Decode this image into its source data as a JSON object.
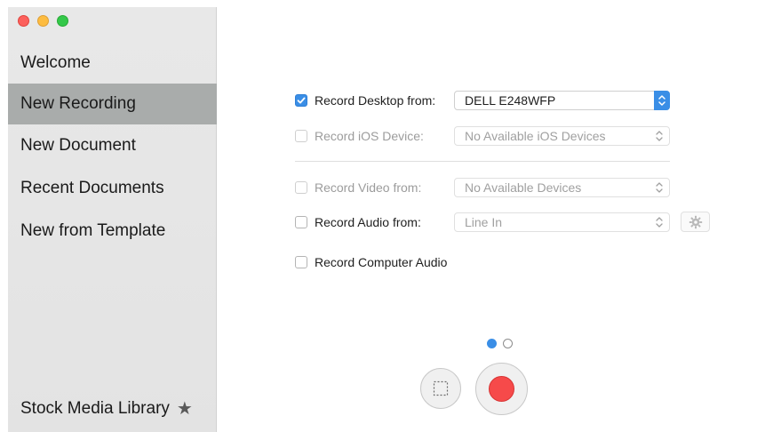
{
  "window": {
    "traffic_lights": [
      "close",
      "minimize",
      "zoom"
    ]
  },
  "sidebar": {
    "items": [
      {
        "label": "Welcome",
        "selected": false
      },
      {
        "label": "New Recording",
        "selected": true
      },
      {
        "label": "New Document",
        "selected": false
      },
      {
        "label": "Recent Documents",
        "selected": false
      },
      {
        "label": "New from Template",
        "selected": false
      }
    ],
    "footer": {
      "label": "Stock Media Library",
      "icon": "star-icon"
    }
  },
  "options": {
    "record_desktop": {
      "label": "Record Desktop from:",
      "checked": true,
      "enabled": true,
      "value": "DELL E248WFP"
    },
    "record_ios": {
      "label": "Record iOS Device:",
      "checked": false,
      "enabled": false,
      "value": "No Available iOS Devices"
    },
    "record_video": {
      "label": "Record Video from:",
      "checked": false,
      "enabled": false,
      "value": "No Available Devices"
    },
    "record_audio": {
      "label": "Record Audio from:",
      "checked": false,
      "enabled": true,
      "value": "Line In"
    },
    "record_computer_audio": {
      "label": "Record Computer Audio",
      "checked": false,
      "enabled": true
    }
  },
  "pager": {
    "pages": 2,
    "current": 1
  },
  "colors": {
    "accent": "#3a8ee6",
    "record": "#f64a4a",
    "selected_row": "#a9acab"
  }
}
